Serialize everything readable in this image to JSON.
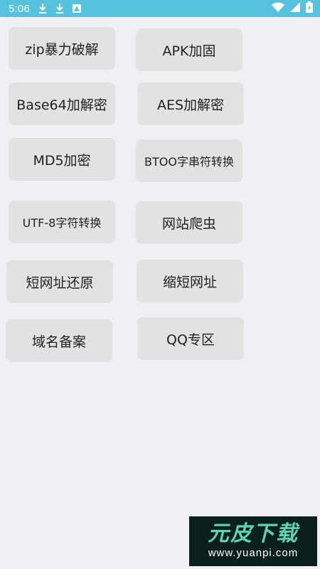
{
  "status_bar": {
    "time": "5:06",
    "icons_left": [
      "download-icon",
      "download-icon",
      "alert-icon"
    ],
    "icons_right": [
      "wifi-icon",
      "signal-icon",
      "battery-icon"
    ],
    "color": "#55c2de"
  },
  "buttons": {
    "zip": "zip暴力破解",
    "apk": "APK加固",
    "base64": "Base64加解密",
    "aes": "AES加解密",
    "md5": "MD5加密",
    "btoo": "BTOO字串符转换",
    "utf8": "UTF-8字符转换",
    "crawler": "网站爬虫",
    "short_restore": "短网址还原",
    "short_make": "缩短网址",
    "domain": "域名备案",
    "qq": "QQ专区"
  },
  "watermark": {
    "title": "元皮下载",
    "url": "www.yuanpi.com"
  }
}
